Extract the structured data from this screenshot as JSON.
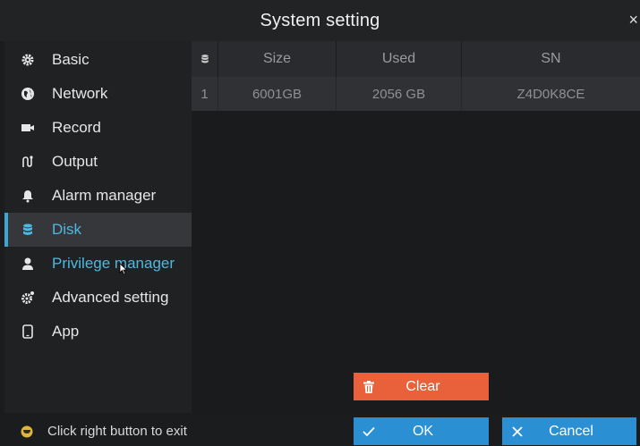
{
  "window": {
    "title": "System setting",
    "close_glyph": "×"
  },
  "sidebar": {
    "items": [
      {
        "label": "Basic",
        "icon": "gear-icon"
      },
      {
        "label": "Network",
        "icon": "globe-icon"
      },
      {
        "label": "Record",
        "icon": "video-camera-icon"
      },
      {
        "label": "Output",
        "icon": "output-icon"
      },
      {
        "label": "Alarm manager",
        "icon": "bell-icon"
      },
      {
        "label": "Disk",
        "icon": "database-icon",
        "state": "selected"
      },
      {
        "label": "Privilege manager",
        "icon": "user-icon",
        "state": "hovered"
      },
      {
        "label": "Advanced setting",
        "icon": "advanced-gear-icon"
      },
      {
        "label": "App",
        "icon": "phone-icon"
      }
    ]
  },
  "disk_table": {
    "columns": [
      "Size",
      "Used",
      "SN"
    ],
    "rows": [
      {
        "index": "1",
        "size": "6001GB",
        "used": "2056 GB",
        "sn": "Z4D0K8CE"
      }
    ]
  },
  "buttons": {
    "clear": "Clear",
    "ok": "OK",
    "cancel": "Cancel"
  },
  "status": {
    "hint": "Click right button to exit"
  },
  "colors": {
    "accent": "#3aa7d8",
    "selected_text": "#4fb8e0",
    "clear_button": "#e9613a",
    "primary_button": "#2b8fd4"
  }
}
